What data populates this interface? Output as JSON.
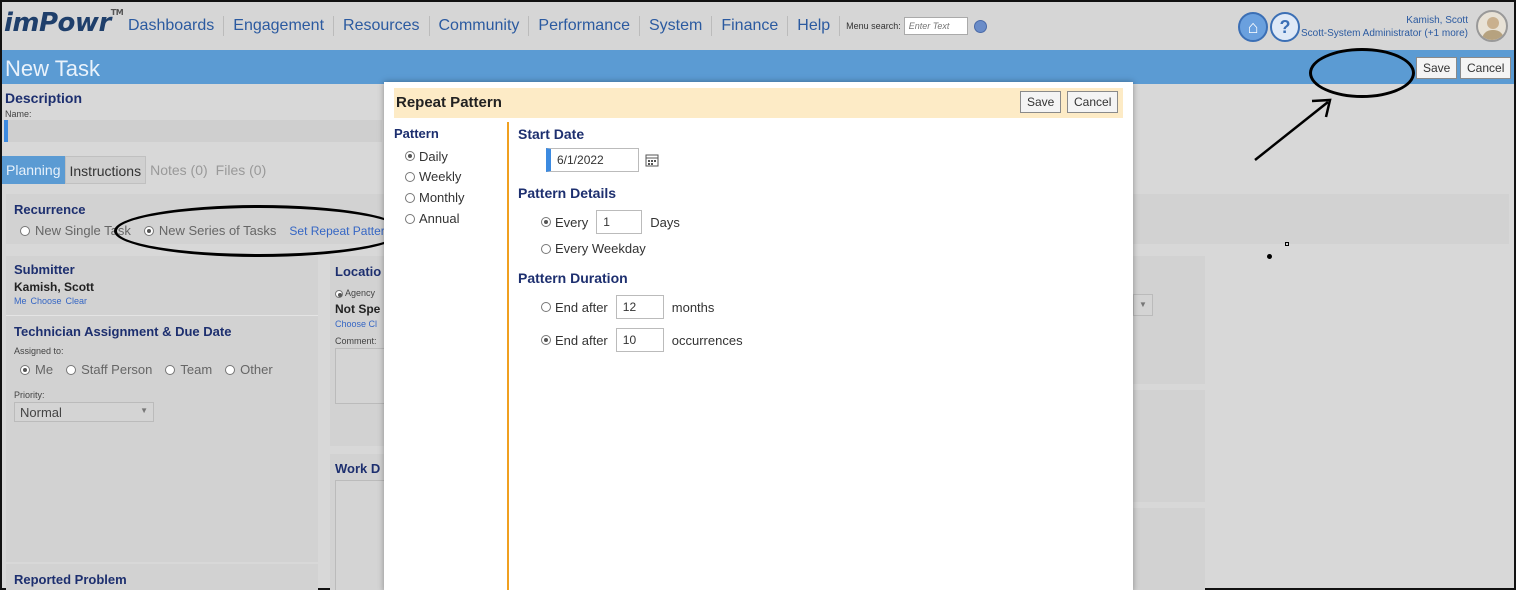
{
  "app": {
    "logo": "imPowr",
    "logo_tm": "TM"
  },
  "nav": {
    "items": [
      "Dashboards",
      "Engagement",
      "Resources",
      "Community",
      "Performance",
      "System",
      "Finance",
      "Help"
    ],
    "menu_search_label": "Menu search:",
    "menu_search_placeholder": "Enter Text"
  },
  "user": {
    "name": "Kamish, Scott",
    "role": "Scott-System Administrator (+1 more)"
  },
  "page": {
    "title": "New Task",
    "save": "Save",
    "cancel": "Cancel"
  },
  "form": {
    "description_heading": "Description",
    "name_label": "Name:",
    "tabs": [
      "Planning",
      "Instructions",
      "Notes (0)",
      "Files (0)"
    ],
    "recurrence": {
      "heading": "Recurrence",
      "option_single": "New Single Task",
      "option_series": "New Series of Tasks",
      "link": "Set Repeat Pattern"
    },
    "submitter": {
      "heading": "Submitter",
      "name": "Kamish, Scott",
      "links": [
        "Me",
        "Choose",
        "Clear"
      ]
    },
    "location": {
      "heading": "Locatio",
      "agency": "Agency",
      "value": "Not Spe",
      "links": "Choose Cl",
      "comment": "Comment:"
    },
    "technician": {
      "heading": "Technician Assignment & Due Date",
      "assigned_label": "Assigned to:",
      "options": [
        "Me",
        "Staff Person",
        "Team",
        "Other"
      ],
      "priority_label": "Priority:",
      "priority_value": "Normal"
    },
    "work_heading": "Work D",
    "reported_heading": "Reported Problem"
  },
  "modal": {
    "title": "Repeat Pattern",
    "save": "Save",
    "cancel": "Cancel",
    "pattern_heading": "Pattern",
    "patterns": [
      "Daily",
      "Weekly",
      "Monthly",
      "Annual"
    ],
    "selected_pattern": "Daily",
    "start_date_heading": "Start Date",
    "start_date": "6/1/2022",
    "details_heading": "Pattern Details",
    "every_label": "Every",
    "every_value": "1",
    "days_label": "Days",
    "every_weekday": "Every Weekday",
    "duration_heading": "Pattern Duration",
    "end_after_label": "End after",
    "end_after_months_value": "12",
    "months_label": "months",
    "end_after_occ_value": "10",
    "occurrences_label": "occurrences"
  },
  "colors": {
    "accent": "#5b9bd3",
    "heading": "#1d2f6f",
    "modal_header": "#fdebc6",
    "divider": "#f0a020"
  }
}
